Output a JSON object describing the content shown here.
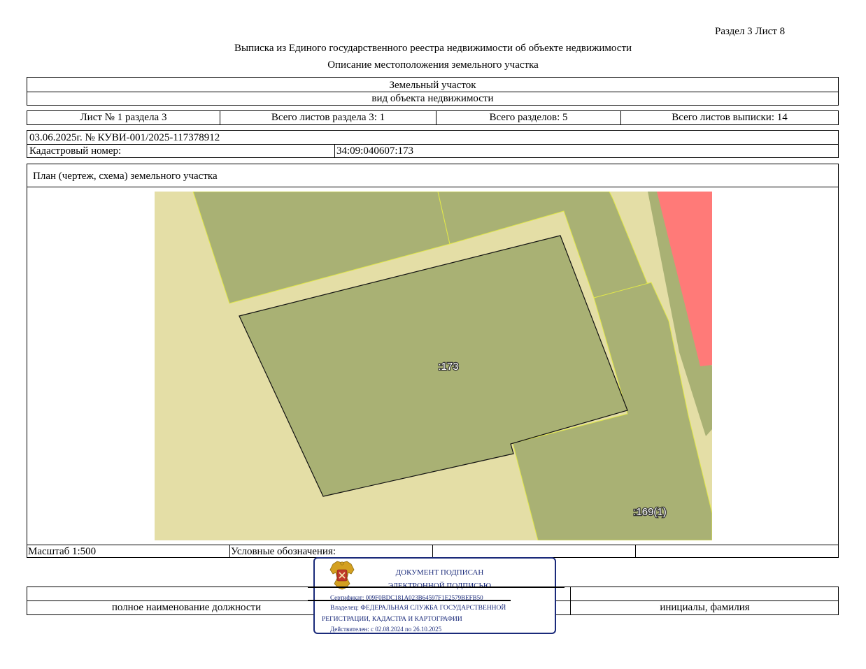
{
  "header": {
    "section_sheet": "Раздел 3    Лист 8",
    "title": "Выписка из Единого государственного реестра недвижимости об объекте недвижимости",
    "subtitle": "Описание местоположения земельного участка"
  },
  "object": {
    "type": "Земельный участок",
    "type_caption": "вид объекта недвижимости"
  },
  "sheets": {
    "sheet_of_section": "Лист № 1 раздела 3",
    "total_section_sheets": "Всего листов раздела 3: 1",
    "total_sections": "Всего разделов: 5",
    "total_extract_sheets": "Всего листов выписки: 14"
  },
  "record": {
    "date_number": "03.06.2025г. № КУВИ-001/2025-117378912",
    "cadastral_label": "Кадастровый номер:",
    "cadastral_value": "34:09:040607:173"
  },
  "plan": {
    "title": "План (чертеж, схема) земельного участка",
    "labels": [
      ":173",
      ":169(1)"
    ],
    "colors": {
      "background": "#e4dea6",
      "parcel": "#a9b174",
      "restricted": "#ff7a78",
      "boundary_yellow": "#e2e84a"
    }
  },
  "footer": {
    "scale": "Масштаб 1:500",
    "legend": "Условные обозначения:",
    "position_caption": "полное наименование должности",
    "name_caption": "инициалы, фамилия"
  },
  "stamp": {
    "line1": "ДОКУМЕНТ ПОДПИСАН",
    "line2": "ЭЛЕКТРОННОЙ ПОДПИСЬЮ",
    "certificate": "Сертификат: 009F0BDC181A023B64597F1E2579BEFB50",
    "owner1": "Владелец: ФЕДЕРАЛЬНАЯ СЛУЖБА ГОСУДАРСТВЕННОЙ",
    "owner2": "РЕГИСТРАЦИИ, КАДАСТРА И КАРТОГРАФИИ",
    "validity": "Действителен: с 02.08.2024 по 26.10.2025"
  }
}
